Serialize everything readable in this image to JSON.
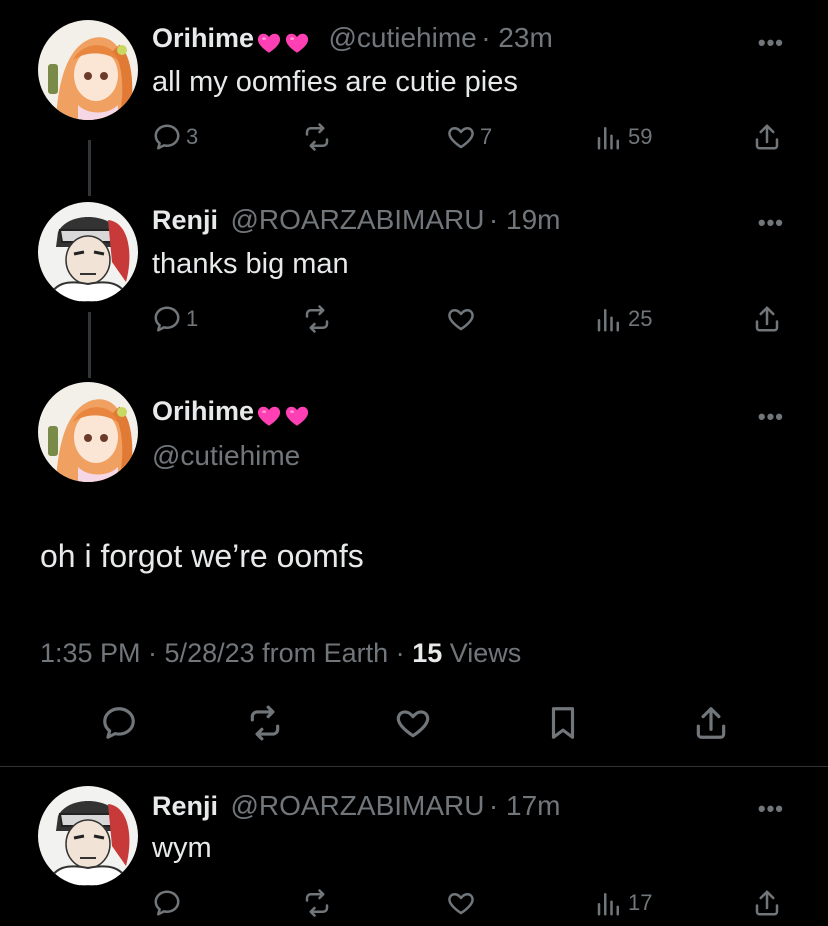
{
  "tweets": [
    {
      "name": "Orihime",
      "handle": "@cutiehime",
      "time": "· 23m",
      "text": "all my oomfies are cutie pies",
      "replies": "3",
      "likes": "7",
      "views": "59"
    },
    {
      "name": "Renji",
      "handle": "@ROARZABIMARU",
      "time": "· 19m",
      "text": "thanks big man",
      "replies": "1",
      "views": "25"
    }
  ],
  "main_tweet": {
    "name": "Orihime",
    "handle": "@cutiehime",
    "text": "oh i forgot we’re oomfs",
    "timestamp": "1:35 PM · 5/28/23 from Earth ·",
    "views_count": "15",
    "views_label": "Views"
  },
  "reply": {
    "name": "Renji",
    "handle": "@ROARZABIMARU",
    "time": "· 17m",
    "text": "wym",
    "views": "17"
  },
  "more_label": "•••",
  "colors": {
    "background": "#000000",
    "text": "#e7e9ea",
    "muted": "#71767b",
    "heart_emoji": "#ff3fb4"
  }
}
